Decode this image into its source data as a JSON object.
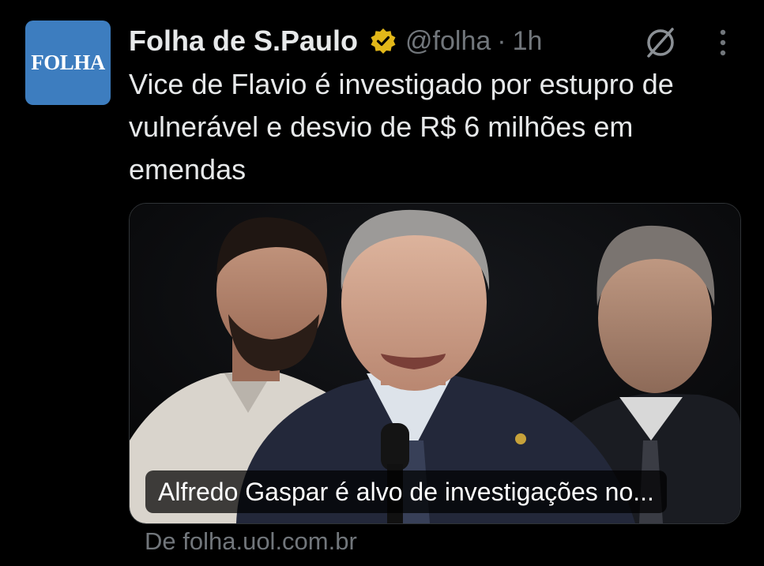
{
  "tweet": {
    "avatar_text": "FOLHA",
    "display_name": "Folha de S.Paulo",
    "handle": "@folha",
    "separator": "·",
    "time": "1h",
    "text": "Vice de Flavio é investigado por estupro de vulnerável e desvio de R$ 6 milhões em emendas",
    "verified_badge_color": "#e2b719",
    "icons": [
      "verified-badge-icon",
      "grok-icon",
      "more-options-icon"
    ]
  },
  "card": {
    "caption": "Alfredo Gaspar é alvo de investigações no...",
    "source": "De folha.uol.com.br"
  },
  "colors": {
    "background": "#000000",
    "text_primary": "#e7e9ea",
    "text_secondary": "#71767b",
    "avatar_bg": "#3d7dbf"
  }
}
